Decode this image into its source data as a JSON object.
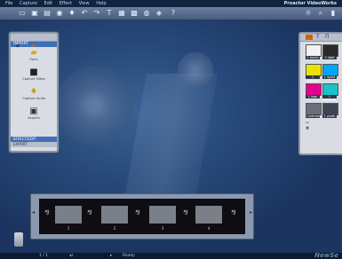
{
  "menu": [
    "File",
    "Capture",
    "Edit",
    "Effect",
    "View",
    "Help"
  ],
  "app_title": "Proactor VideoWorks",
  "toolbar_icons": [
    "folder-icon",
    "save-icon",
    "film-icon",
    "camera-icon",
    "mic-icon",
    "undo-icon",
    "redo-icon",
    "text-icon",
    "image-icon",
    "grid-icon",
    "audio-icon",
    "settings-icon",
    "help-icon"
  ],
  "toolbar_right_icons": [
    "bulb-icon",
    "zoom-icon",
    "trash-icon"
  ],
  "left_panel": {
    "tab": "IMPORT",
    "items": [
      {
        "label": "Open",
        "icon": "folder-icon"
      },
      {
        "label": "Capture Video",
        "icon": "video-camera-icon"
      },
      {
        "label": "Capture Audio",
        "icon": "microphone-icon"
      },
      {
        "label": "Acquire",
        "icon": "scanner-icon"
      }
    ],
    "bottom_tabs": [
      "EFFECT/EDIT",
      "EXPORT"
    ]
  },
  "right_panel": {
    "tabs": [
      "clips-tab",
      "text-tab",
      "effects-tab"
    ],
    "clips": [
      {
        "label": "1 bomb",
        "color": "#f2f2f2"
      },
      {
        "label": "1 light",
        "color": "#2a2a2a"
      },
      {
        "label": "1 hiappell",
        "color": "#e9e300"
      },
      {
        "label": "1 light4",
        "color": "#00a6ff"
      },
      {
        "label": "1 logo",
        "color": "#e2008c"
      },
      {
        "label": "1 timenow",
        "color": "#19c3c8"
      },
      {
        "label": "1 oldman",
        "color": "#6a6f79"
      },
      {
        "label": "1 youth",
        "color": "#3d4555"
      }
    ]
  },
  "storyboard": {
    "frames": [
      "1",
      "2",
      "3",
      "4"
    ]
  },
  "status": {
    "page": "1 / 1",
    "state": "Ready"
  },
  "watermark": "NewSe"
}
